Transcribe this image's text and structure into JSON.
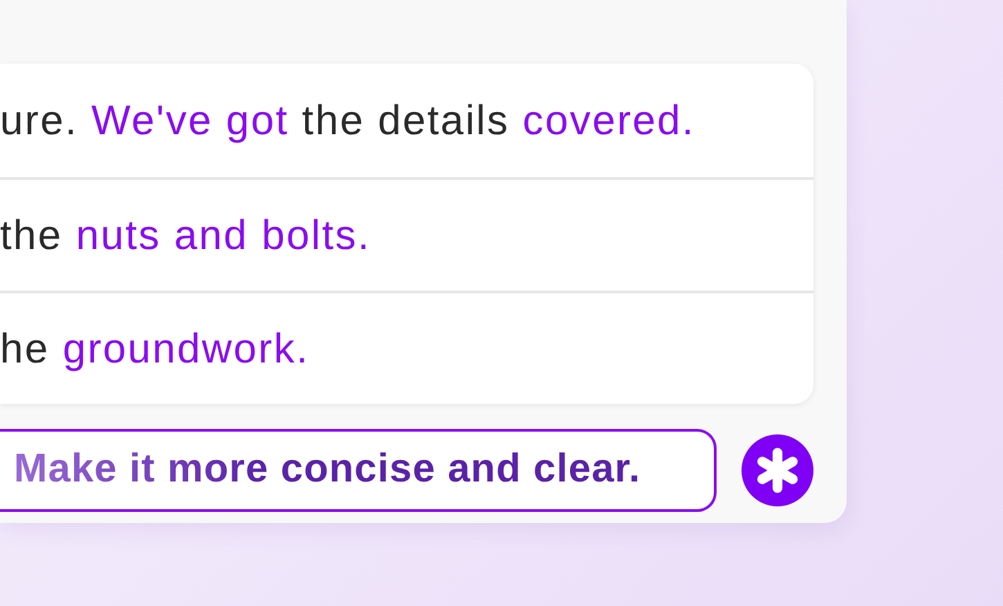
{
  "rows": [
    {
      "segments": [
        {
          "text": "ure. ",
          "highlighted": false
        },
        {
          "text": "We've got",
          "highlighted": true
        },
        {
          "text": " the details ",
          "highlighted": false
        },
        {
          "text": "covered.",
          "highlighted": true
        }
      ]
    },
    {
      "segments": [
        {
          "text": "the ",
          "highlighted": false
        },
        {
          "text": "nuts and bolts.",
          "highlighted": true
        }
      ]
    },
    {
      "segments": [
        {
          "text": "he ",
          "highlighted": false
        },
        {
          "text": "groundwork.",
          "highlighted": true
        }
      ]
    }
  ],
  "prompt": {
    "value": "Make it more concise and clear."
  }
}
